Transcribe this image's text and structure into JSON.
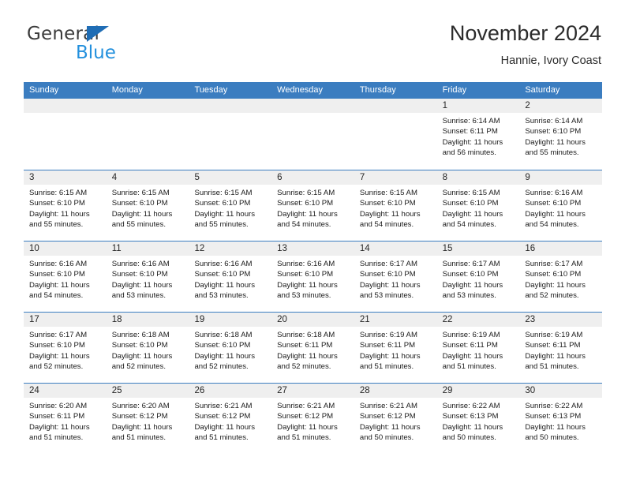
{
  "brand": {
    "name_top": "General",
    "name_bottom": "Blue",
    "triangle_color": "#1f6db5",
    "blue_text_color": "#2390dd"
  },
  "header": {
    "title": "November 2024",
    "subtitle": "Hannie, Ivory Coast"
  },
  "theme": {
    "header_blue": "#3b7dc0",
    "daynum_gray": "#efefef",
    "text_color": "#1a1a1a"
  },
  "weekdays": [
    "Sunday",
    "Monday",
    "Tuesday",
    "Wednesday",
    "Thursday",
    "Friday",
    "Saturday"
  ],
  "labels": {
    "sunrise_prefix": "Sunrise:",
    "sunset_prefix": "Sunset:",
    "daylight_prefix": "Daylight:"
  },
  "weeks": [
    [
      {
        "day": "",
        "sunrise": "",
        "sunset": "",
        "daylight_line1": "",
        "daylight_line2": ""
      },
      {
        "day": "",
        "sunrise": "",
        "sunset": "",
        "daylight_line1": "",
        "daylight_line2": ""
      },
      {
        "day": "",
        "sunrise": "",
        "sunset": "",
        "daylight_line1": "",
        "daylight_line2": ""
      },
      {
        "day": "",
        "sunrise": "",
        "sunset": "",
        "daylight_line1": "",
        "daylight_line2": ""
      },
      {
        "day": "",
        "sunrise": "",
        "sunset": "",
        "daylight_line1": "",
        "daylight_line2": ""
      },
      {
        "day": "1",
        "sunrise": "Sunrise: 6:14 AM",
        "sunset": "Sunset: 6:11 PM",
        "daylight_line1": "Daylight: 11 hours",
        "daylight_line2": "and 56 minutes."
      },
      {
        "day": "2",
        "sunrise": "Sunrise: 6:14 AM",
        "sunset": "Sunset: 6:10 PM",
        "daylight_line1": "Daylight: 11 hours",
        "daylight_line2": "and 55 minutes."
      }
    ],
    [
      {
        "day": "3",
        "sunrise": "Sunrise: 6:15 AM",
        "sunset": "Sunset: 6:10 PM",
        "daylight_line1": "Daylight: 11 hours",
        "daylight_line2": "and 55 minutes."
      },
      {
        "day": "4",
        "sunrise": "Sunrise: 6:15 AM",
        "sunset": "Sunset: 6:10 PM",
        "daylight_line1": "Daylight: 11 hours",
        "daylight_line2": "and 55 minutes."
      },
      {
        "day": "5",
        "sunrise": "Sunrise: 6:15 AM",
        "sunset": "Sunset: 6:10 PM",
        "daylight_line1": "Daylight: 11 hours",
        "daylight_line2": "and 55 minutes."
      },
      {
        "day": "6",
        "sunrise": "Sunrise: 6:15 AM",
        "sunset": "Sunset: 6:10 PM",
        "daylight_line1": "Daylight: 11 hours",
        "daylight_line2": "and 54 minutes."
      },
      {
        "day": "7",
        "sunrise": "Sunrise: 6:15 AM",
        "sunset": "Sunset: 6:10 PM",
        "daylight_line1": "Daylight: 11 hours",
        "daylight_line2": "and 54 minutes."
      },
      {
        "day": "8",
        "sunrise": "Sunrise: 6:15 AM",
        "sunset": "Sunset: 6:10 PM",
        "daylight_line1": "Daylight: 11 hours",
        "daylight_line2": "and 54 minutes."
      },
      {
        "day": "9",
        "sunrise": "Sunrise: 6:16 AM",
        "sunset": "Sunset: 6:10 PM",
        "daylight_line1": "Daylight: 11 hours",
        "daylight_line2": "and 54 minutes."
      }
    ],
    [
      {
        "day": "10",
        "sunrise": "Sunrise: 6:16 AM",
        "sunset": "Sunset: 6:10 PM",
        "daylight_line1": "Daylight: 11 hours",
        "daylight_line2": "and 54 minutes."
      },
      {
        "day": "11",
        "sunrise": "Sunrise: 6:16 AM",
        "sunset": "Sunset: 6:10 PM",
        "daylight_line1": "Daylight: 11 hours",
        "daylight_line2": "and 53 minutes."
      },
      {
        "day": "12",
        "sunrise": "Sunrise: 6:16 AM",
        "sunset": "Sunset: 6:10 PM",
        "daylight_line1": "Daylight: 11 hours",
        "daylight_line2": "and 53 minutes."
      },
      {
        "day": "13",
        "sunrise": "Sunrise: 6:16 AM",
        "sunset": "Sunset: 6:10 PM",
        "daylight_line1": "Daylight: 11 hours",
        "daylight_line2": "and 53 minutes."
      },
      {
        "day": "14",
        "sunrise": "Sunrise: 6:17 AM",
        "sunset": "Sunset: 6:10 PM",
        "daylight_line1": "Daylight: 11 hours",
        "daylight_line2": "and 53 minutes."
      },
      {
        "day": "15",
        "sunrise": "Sunrise: 6:17 AM",
        "sunset": "Sunset: 6:10 PM",
        "daylight_line1": "Daylight: 11 hours",
        "daylight_line2": "and 53 minutes."
      },
      {
        "day": "16",
        "sunrise": "Sunrise: 6:17 AM",
        "sunset": "Sunset: 6:10 PM",
        "daylight_line1": "Daylight: 11 hours",
        "daylight_line2": "and 52 minutes."
      }
    ],
    [
      {
        "day": "17",
        "sunrise": "Sunrise: 6:17 AM",
        "sunset": "Sunset: 6:10 PM",
        "daylight_line1": "Daylight: 11 hours",
        "daylight_line2": "and 52 minutes."
      },
      {
        "day": "18",
        "sunrise": "Sunrise: 6:18 AM",
        "sunset": "Sunset: 6:10 PM",
        "daylight_line1": "Daylight: 11 hours",
        "daylight_line2": "and 52 minutes."
      },
      {
        "day": "19",
        "sunrise": "Sunrise: 6:18 AM",
        "sunset": "Sunset: 6:10 PM",
        "daylight_line1": "Daylight: 11 hours",
        "daylight_line2": "and 52 minutes."
      },
      {
        "day": "20",
        "sunrise": "Sunrise: 6:18 AM",
        "sunset": "Sunset: 6:11 PM",
        "daylight_line1": "Daylight: 11 hours",
        "daylight_line2": "and 52 minutes."
      },
      {
        "day": "21",
        "sunrise": "Sunrise: 6:19 AM",
        "sunset": "Sunset: 6:11 PM",
        "daylight_line1": "Daylight: 11 hours",
        "daylight_line2": "and 51 minutes."
      },
      {
        "day": "22",
        "sunrise": "Sunrise: 6:19 AM",
        "sunset": "Sunset: 6:11 PM",
        "daylight_line1": "Daylight: 11 hours",
        "daylight_line2": "and 51 minutes."
      },
      {
        "day": "23",
        "sunrise": "Sunrise: 6:19 AM",
        "sunset": "Sunset: 6:11 PM",
        "daylight_line1": "Daylight: 11 hours",
        "daylight_line2": "and 51 minutes."
      }
    ],
    [
      {
        "day": "24",
        "sunrise": "Sunrise: 6:20 AM",
        "sunset": "Sunset: 6:11 PM",
        "daylight_line1": "Daylight: 11 hours",
        "daylight_line2": "and 51 minutes."
      },
      {
        "day": "25",
        "sunrise": "Sunrise: 6:20 AM",
        "sunset": "Sunset: 6:12 PM",
        "daylight_line1": "Daylight: 11 hours",
        "daylight_line2": "and 51 minutes."
      },
      {
        "day": "26",
        "sunrise": "Sunrise: 6:21 AM",
        "sunset": "Sunset: 6:12 PM",
        "daylight_line1": "Daylight: 11 hours",
        "daylight_line2": "and 51 minutes."
      },
      {
        "day": "27",
        "sunrise": "Sunrise: 6:21 AM",
        "sunset": "Sunset: 6:12 PM",
        "daylight_line1": "Daylight: 11 hours",
        "daylight_line2": "and 51 minutes."
      },
      {
        "day": "28",
        "sunrise": "Sunrise: 6:21 AM",
        "sunset": "Sunset: 6:12 PM",
        "daylight_line1": "Daylight: 11 hours",
        "daylight_line2": "and 50 minutes."
      },
      {
        "day": "29",
        "sunrise": "Sunrise: 6:22 AM",
        "sunset": "Sunset: 6:13 PM",
        "daylight_line1": "Daylight: 11 hours",
        "daylight_line2": "and 50 minutes."
      },
      {
        "day": "30",
        "sunrise": "Sunrise: 6:22 AM",
        "sunset": "Sunset: 6:13 PM",
        "daylight_line1": "Daylight: 11 hours",
        "daylight_line2": "and 50 minutes."
      }
    ]
  ]
}
